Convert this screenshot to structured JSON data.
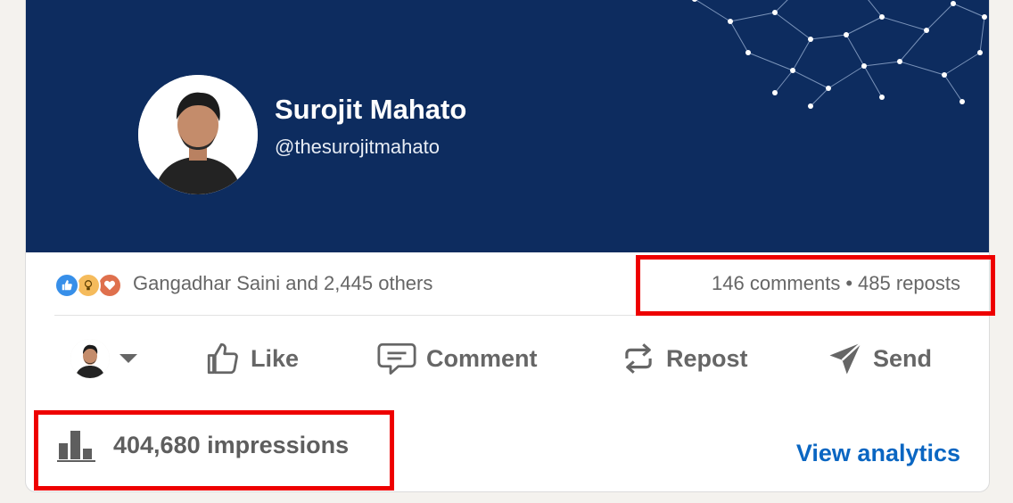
{
  "author": {
    "name": "Surojit Mahato",
    "handle": "@thesurojitmahato"
  },
  "social": {
    "reactions_text": "Gangadhar Saini and 2,445 others",
    "reaction_icons": [
      "like-icon",
      "insightful-icon",
      "love-icon"
    ],
    "comments": "146 comments",
    "separator": "•",
    "reposts": "485 reposts"
  },
  "actions": {
    "like": "Like",
    "comment": "Comment",
    "repost": "Repost",
    "send": "Send"
  },
  "analytics": {
    "impressions": "404,680 impressions",
    "view_analytics": "View analytics"
  },
  "colors": {
    "banner": "#0d2c5f",
    "link": "#0a66c2",
    "highlight": "#ee0000",
    "like": "#378fe9",
    "insightful": "#f5bb5c",
    "love": "#df704d"
  }
}
